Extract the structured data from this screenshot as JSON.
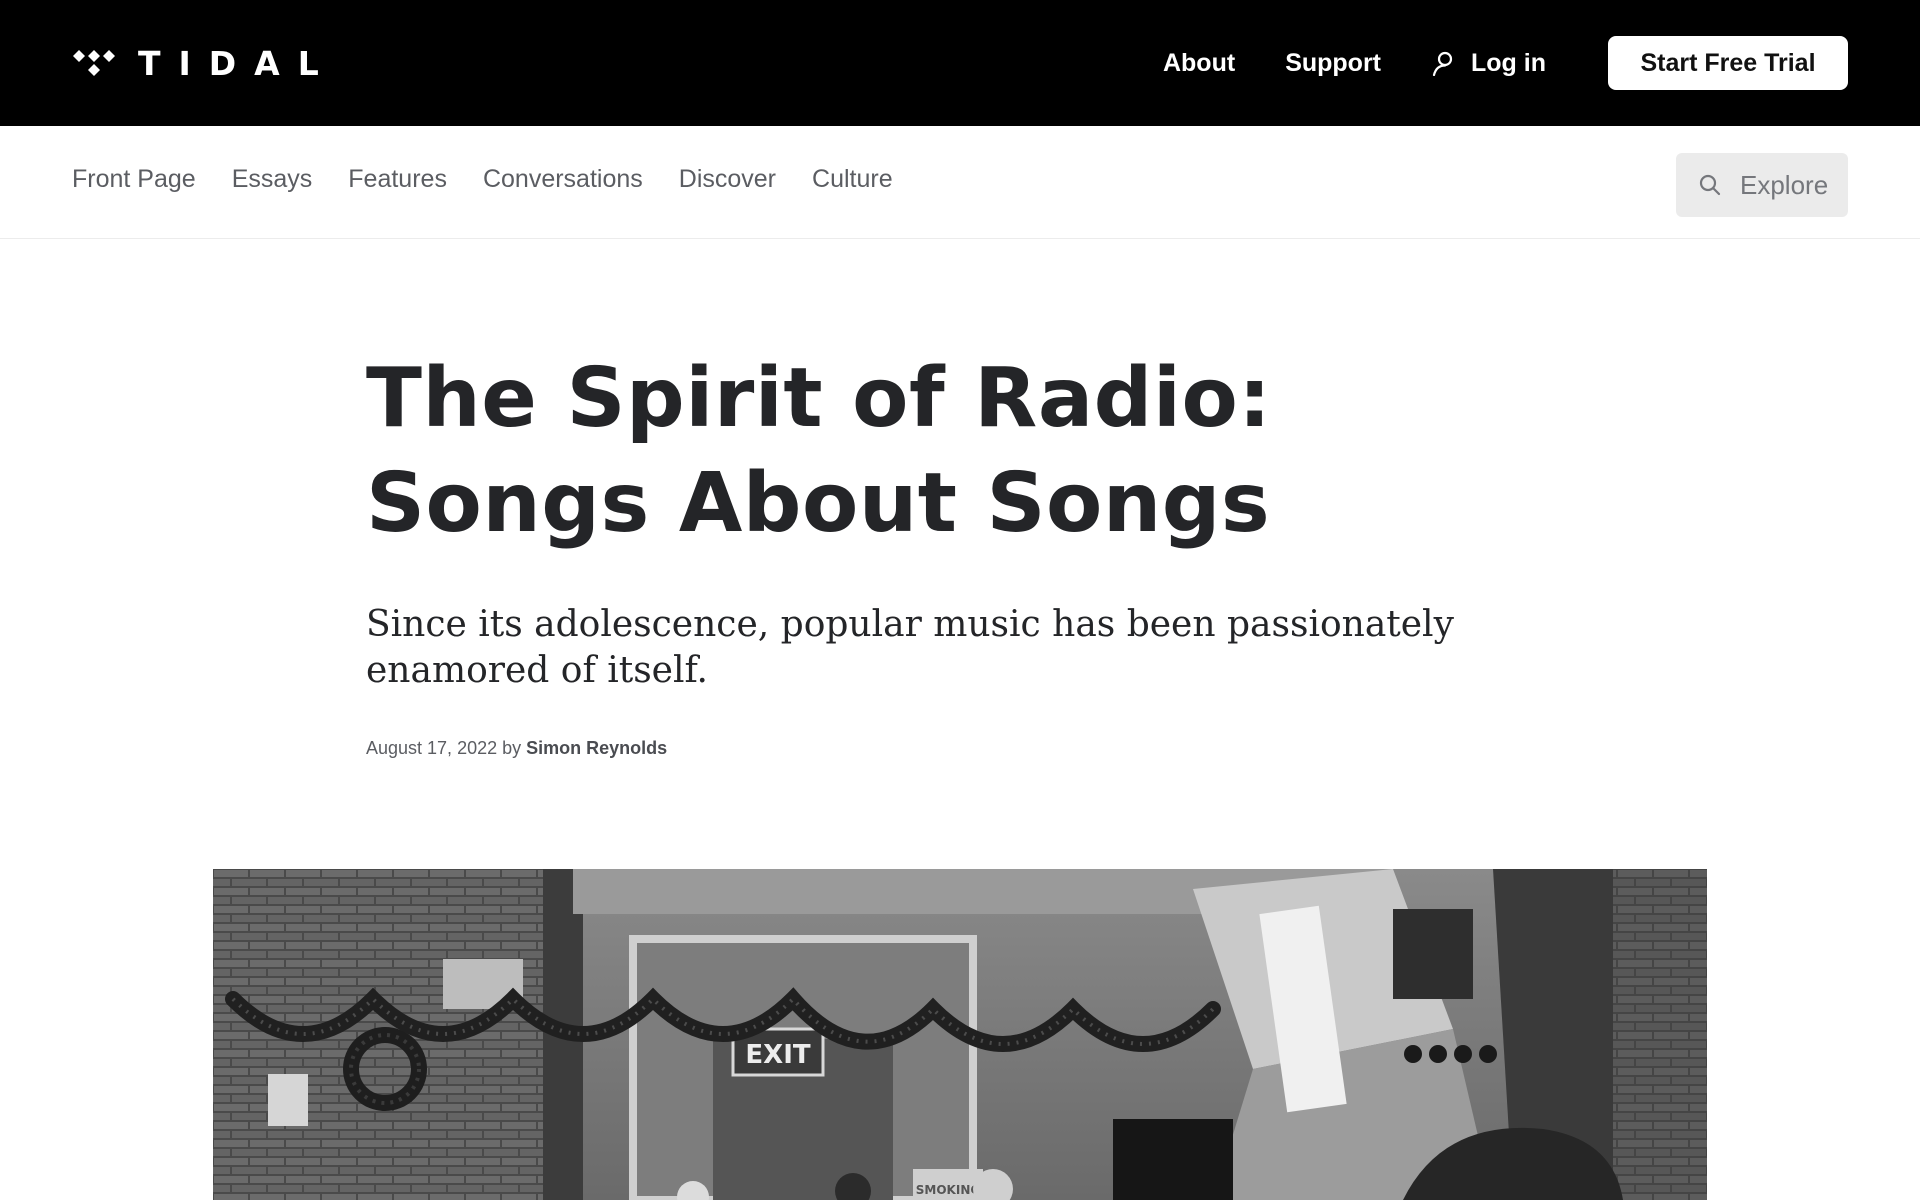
{
  "brand": {
    "name": "TIDAL",
    "logo_icon": "tidal-diamonds-icon"
  },
  "header": {
    "nav": [
      {
        "label": "About"
      },
      {
        "label": "Support"
      }
    ],
    "login_label": "Log in",
    "login_icon": "user-icon",
    "cta_label": "Start Free Trial"
  },
  "subnav": {
    "items": [
      {
        "label": "Front Page"
      },
      {
        "label": "Essays"
      },
      {
        "label": "Features"
      },
      {
        "label": "Conversations"
      },
      {
        "label": "Discover"
      },
      {
        "label": "Culture"
      }
    ],
    "explore_label": "Explore",
    "explore_icon": "search-icon"
  },
  "article": {
    "title": "The Spirit of Radio: Songs About Songs",
    "dek": "Since its adolescence, popular music has been passionately enamored of itself.",
    "date": "August 17, 2022",
    "by": "by",
    "author": "Simon Reynolds"
  },
  "hero": {
    "sign_exit": "EXIT",
    "sign_smoking": "SMOKING"
  },
  "colors": {
    "header_bg": "#000000",
    "text_dark": "#242528",
    "text_muted": "#5b5d62",
    "explore_bg": "#ebebeb"
  }
}
